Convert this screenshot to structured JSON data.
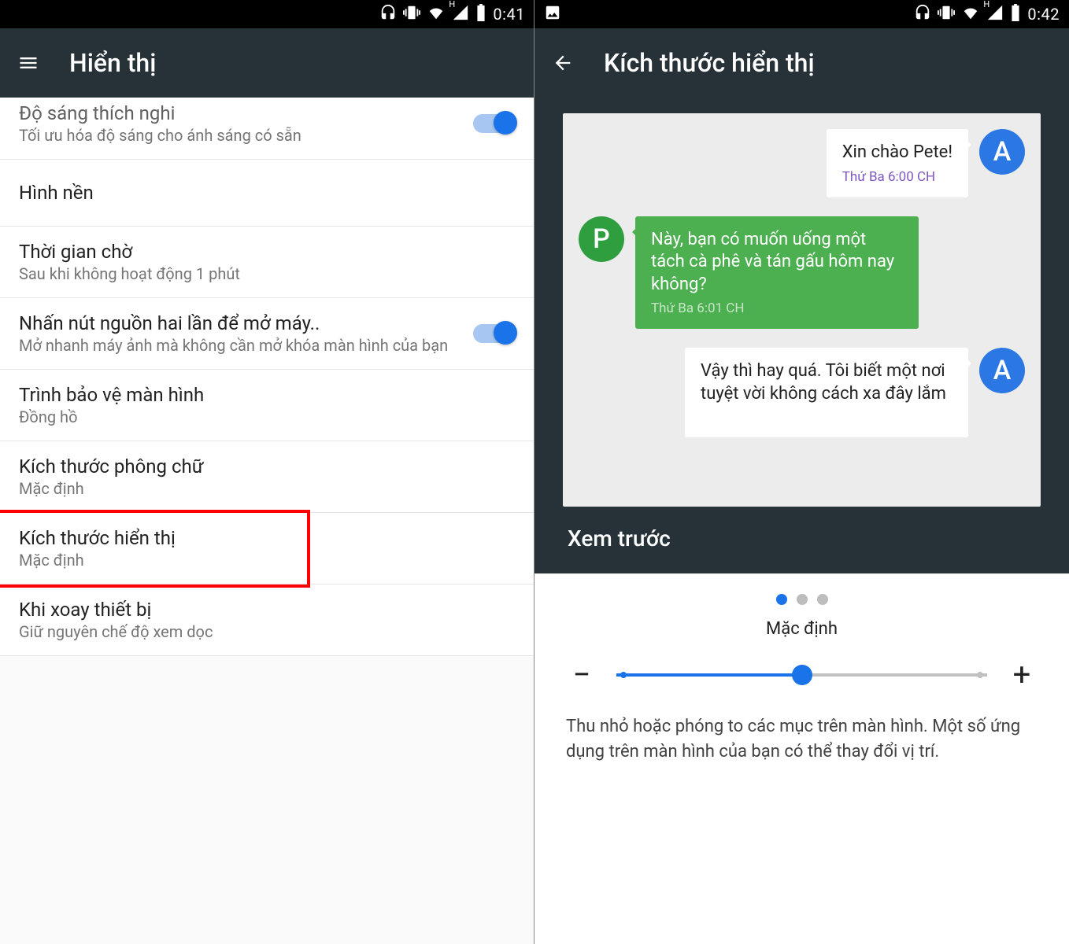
{
  "left": {
    "status_time": "0:41",
    "title": "Hiển thị",
    "rows": [
      {
        "primary": "Độ sáng thích nghi",
        "secondary": "Tối ưu hóa độ sáng cho ánh sáng có sẵn",
        "toggle": true
      },
      {
        "primary": "Hình nền",
        "secondary": ""
      },
      {
        "primary": "Thời gian chờ",
        "secondary": "Sau khi không hoạt động 1 phút"
      },
      {
        "primary": "Nhấn nút nguồn hai lần để mở máy..",
        "secondary": "Mở nhanh máy ảnh mà không cần mở khóa màn hình của bạn",
        "toggle": true
      },
      {
        "primary": "Trình bảo vệ màn hình",
        "secondary": "Đồng hồ"
      },
      {
        "primary": "Kích thước phông chữ",
        "secondary": "Mặc định"
      },
      {
        "primary": "Kích thước hiển thị",
        "secondary": "Mặc định",
        "highlight": true
      },
      {
        "primary": "Khi xoay thiết bị",
        "secondary": "Giữ nguyên chế độ xem dọc"
      }
    ]
  },
  "right": {
    "status_time": "0:42",
    "title": "Kích thước hiển thị",
    "chat": [
      {
        "side": "right",
        "avatar": "A",
        "avatar_color": "blue",
        "msg": "Xin chào Pete!",
        "ts": "Thứ Ba 6:00 CH",
        "bubble": "white"
      },
      {
        "side": "left",
        "avatar": "P",
        "avatar_color": "green",
        "msg": "Này, bạn có muốn uống một tách cà phê và tán gấu hôm nay không?",
        "ts": "Thứ Ba 6:01 CH",
        "bubble": "green"
      },
      {
        "side": "right",
        "avatar": "A",
        "avatar_color": "blue",
        "msg": "Vậy thì hay quá. Tôi biết một nơi tuyệt vời không cách xa đây lắm",
        "ts": "",
        "bubble": "white"
      }
    ],
    "preview_label": "Xem trước",
    "size_label": "Mặc định",
    "minus": "−",
    "plus": "+",
    "description": "Thu nhỏ hoặc phóng to các mục trên màn hình. Một số ứng dụng trên màn hình của bạn có thể thay đổi vị trí."
  }
}
